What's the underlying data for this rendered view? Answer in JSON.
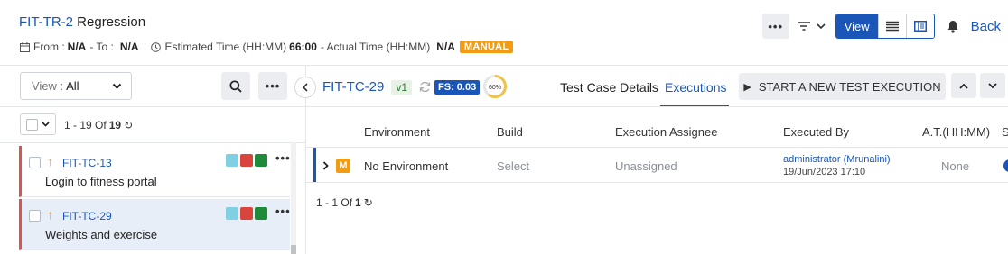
{
  "header": {
    "key": "FIT-TR-2",
    "name": "Regression",
    "from_label": "From :",
    "from_value": "N/A",
    "to_label": "- To :",
    "to_value": "N/A",
    "est_label": "Estimated Time (HH:MM)",
    "est_value": "66:00",
    "actual_label": "- Actual Time (HH:MM)",
    "actual_value": "N/A",
    "badge": "MANUAL"
  },
  "toolbar": {
    "more": "•••",
    "view_label": "View",
    "back_label": "Back"
  },
  "left": {
    "view_label": "View :",
    "view_value": "All",
    "more": "•••",
    "pager": {
      "range": "1 - 19",
      "of": "Of",
      "total": "19"
    },
    "items": [
      {
        "key": "FIT-TC-13",
        "name": "Login to fitness portal",
        "more": "•••"
      },
      {
        "key": "FIT-TC-29",
        "name": "Weights and exercise",
        "more": "•••"
      }
    ],
    "status_colors": [
      "#7fd0e0",
      "#d9453c",
      "#1f8a3a"
    ]
  },
  "detail": {
    "key": "FIT-TC-29",
    "version": "v1",
    "fs": "FS: 0.03",
    "progress_label": "60%",
    "progress_value": 0.6,
    "tabs": [
      "Test Case Details",
      "Executions"
    ],
    "start_button": "START A NEW TEST EXECUTION",
    "columns": [
      "Environment",
      "Build",
      "Execution Assignee",
      "Executed By",
      "A.T.(HH:MM)",
      "S"
    ],
    "row": {
      "type_badge": "M",
      "environment": "No Environment",
      "build": "Select",
      "assignee": "Unassigned",
      "executed_by": "administrator (Mrunalini)",
      "executed_on": "19/Jun/2023 17:10",
      "at": "None"
    },
    "pager": {
      "range": "1 - 1",
      "of": "Of",
      "total": "1"
    }
  }
}
